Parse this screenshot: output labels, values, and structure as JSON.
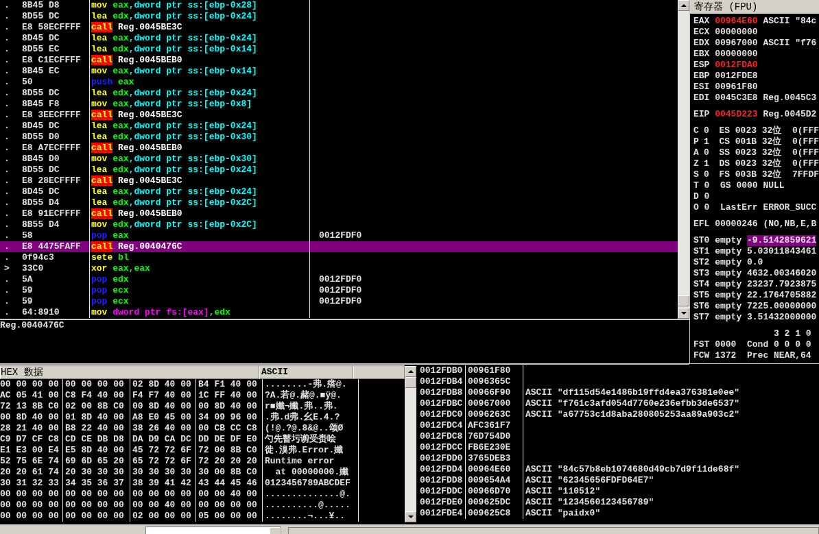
{
  "disassembly": {
    "rows": [
      {
        "marker": ".",
        "bytes": "8B45 D8",
        "instruction": [
          {
            "text": "mov",
            "kind": "op"
          },
          {
            "text": " eax",
            "kind": "reg"
          },
          {
            "text": ",dword ptr ss:[ebp-0x28]",
            "kind": "mem"
          }
        ],
        "selected": false
      },
      {
        "marker": ".",
        "bytes": "8D55 DC",
        "instruction": [
          {
            "text": "lea",
            "kind": "op"
          },
          {
            "text": " edx",
            "kind": "reg"
          },
          {
            "text": ",dword ptr ss:[ebp-0x24]",
            "kind": "mem"
          }
        ],
        "selected": false
      },
      {
        "marker": ".",
        "bytes": "E8 58ECFFFF",
        "instruction": [
          {
            "text": "call",
            "kind": "call"
          },
          {
            "text": " Reg.0045BE3C",
            "kind": "addr"
          }
        ],
        "selected": false
      },
      {
        "marker": ".",
        "bytes": "8D45 DC",
        "instruction": [
          {
            "text": "lea",
            "kind": "op"
          },
          {
            "text": " eax",
            "kind": "reg"
          },
          {
            "text": ",dword ptr ss:[ebp-0x24]",
            "kind": "mem"
          }
        ],
        "selected": false
      },
      {
        "marker": ".",
        "bytes": "8D55 EC",
        "instruction": [
          {
            "text": "lea",
            "kind": "op"
          },
          {
            "text": " edx",
            "kind": "reg"
          },
          {
            "text": ",dword ptr ss:[ebp-0x14]",
            "kind": "mem"
          }
        ],
        "selected": false
      },
      {
        "marker": ".",
        "bytes": "E8 C1ECFFFF",
        "instruction": [
          {
            "text": "call",
            "kind": "call"
          },
          {
            "text": " Reg.0045BEB0",
            "kind": "addr"
          }
        ],
        "selected": false
      },
      {
        "marker": ".",
        "bytes": "8B45 EC",
        "instruction": [
          {
            "text": "mov",
            "kind": "op"
          },
          {
            "text": " eax",
            "kind": "reg"
          },
          {
            "text": ",dword ptr ss:[ebp-0x14]",
            "kind": "mem"
          }
        ],
        "selected": false
      },
      {
        "marker": ".",
        "bytes": "50",
        "instruction": [
          {
            "text": "push",
            "kind": "stack"
          },
          {
            "text": " eax",
            "kind": "reg"
          }
        ],
        "selected": false
      },
      {
        "marker": ".",
        "bytes": "8D55 DC",
        "instruction": [
          {
            "text": "lea",
            "kind": "op"
          },
          {
            "text": " edx",
            "kind": "reg"
          },
          {
            "text": ",dword ptr ss:[ebp-0x24]",
            "kind": "mem"
          }
        ],
        "selected": false
      },
      {
        "marker": ".",
        "bytes": "8B45 F8",
        "instruction": [
          {
            "text": "mov",
            "kind": "op"
          },
          {
            "text": " eax",
            "kind": "reg"
          },
          {
            "text": ",dword ptr ss:[ebp-0x8]",
            "kind": "mem"
          }
        ],
        "selected": false
      },
      {
        "marker": ".",
        "bytes": "E8 3EECFFFF",
        "instruction": [
          {
            "text": "call",
            "kind": "call"
          },
          {
            "text": " Reg.0045BE3C",
            "kind": "addr"
          }
        ],
        "selected": false
      },
      {
        "marker": ".",
        "bytes": "8D45 DC",
        "instruction": [
          {
            "text": "lea",
            "kind": "op"
          },
          {
            "text": " eax",
            "kind": "reg"
          },
          {
            "text": ",dword ptr ss:[ebp-0x24]",
            "kind": "mem"
          }
        ],
        "selected": false
      },
      {
        "marker": ".",
        "bytes": "8D55 D0",
        "instruction": [
          {
            "text": "lea",
            "kind": "op"
          },
          {
            "text": " edx",
            "kind": "reg"
          },
          {
            "text": ",dword ptr ss:[ebp-0x30]",
            "kind": "mem"
          }
        ],
        "selected": false
      },
      {
        "marker": ".",
        "bytes": "E8 A7ECFFFF",
        "instruction": [
          {
            "text": "call",
            "kind": "call"
          },
          {
            "text": " Reg.0045BEB0",
            "kind": "addr"
          }
        ],
        "selected": false
      },
      {
        "marker": ".",
        "bytes": "8B45 D0",
        "instruction": [
          {
            "text": "mov",
            "kind": "op"
          },
          {
            "text": " eax",
            "kind": "reg"
          },
          {
            "text": ",dword ptr ss:[ebp-0x30]",
            "kind": "mem"
          }
        ],
        "selected": false
      },
      {
        "marker": ".",
        "bytes": "8D55 DC",
        "instruction": [
          {
            "text": "lea",
            "kind": "op"
          },
          {
            "text": " edx",
            "kind": "reg"
          },
          {
            "text": ",dword ptr ss:[ebp-0x24]",
            "kind": "mem"
          }
        ],
        "selected": false
      },
      {
        "marker": ".",
        "bytes": "E8 28ECFFFF",
        "instruction": [
          {
            "text": "call",
            "kind": "call"
          },
          {
            "text": " Reg.0045BE3C",
            "kind": "addr"
          }
        ],
        "selected": false
      },
      {
        "marker": ".",
        "bytes": "8D45 DC",
        "instruction": [
          {
            "text": "lea",
            "kind": "op"
          },
          {
            "text": " eax",
            "kind": "reg"
          },
          {
            "text": ",dword ptr ss:[ebp-0x24]",
            "kind": "mem"
          }
        ],
        "selected": false
      },
      {
        "marker": ".",
        "bytes": "8D55 D4",
        "instruction": [
          {
            "text": "lea",
            "kind": "op"
          },
          {
            "text": " edx",
            "kind": "reg"
          },
          {
            "text": ",dword ptr ss:[ebp-0x2C]",
            "kind": "mem"
          }
        ],
        "selected": false
      },
      {
        "marker": ".",
        "bytes": "E8 91ECFFFF",
        "instruction": [
          {
            "text": "call",
            "kind": "call"
          },
          {
            "text": " Reg.0045BEB0",
            "kind": "addr"
          }
        ],
        "selected": false
      },
      {
        "marker": ".",
        "bytes": "8B55 D4",
        "instruction": [
          {
            "text": "mov",
            "kind": "op"
          },
          {
            "text": " edx",
            "kind": "reg"
          },
          {
            "text": ",dword ptr ss:[ebp-0x2C]",
            "kind": "mem"
          }
        ],
        "selected": false
      },
      {
        "marker": ".",
        "bytes": "58",
        "instruction": [
          {
            "text": "pop",
            "kind": "stack"
          },
          {
            "text": " eax",
            "kind": "reg"
          }
        ],
        "comment": "0012FDF0",
        "selected": false
      },
      {
        "marker": ".",
        "bytes": "E8 4475FAFF",
        "instruction": [
          {
            "text": "call",
            "kind": "call"
          },
          {
            "text": " Reg.0040476C",
            "kind": "addr"
          }
        ],
        "selected": true
      },
      {
        "marker": ".",
        "bytes": "0f94c3",
        "instruction": [
          {
            "text": "sete",
            "kind": "op"
          },
          {
            "text": " bl",
            "kind": "reg"
          }
        ],
        "selected": false
      },
      {
        "marker": ">",
        "bytes": "33C0",
        "instruction": [
          {
            "text": "xor",
            "kind": "op"
          },
          {
            "text": " eax,eax",
            "kind": "reg"
          }
        ],
        "selected": false
      },
      {
        "marker": ".",
        "bytes": "5A",
        "instruction": [
          {
            "text": "pop",
            "kind": "stack"
          },
          {
            "text": " edx",
            "kind": "reg"
          }
        ],
        "comment": "0012FDF0",
        "selected": false
      },
      {
        "marker": ".",
        "bytes": "59",
        "instruction": [
          {
            "text": "pop",
            "kind": "stack"
          },
          {
            "text": " ecx",
            "kind": "reg"
          }
        ],
        "comment": "0012FDF0",
        "selected": false
      },
      {
        "marker": ".",
        "bytes": "59",
        "instruction": [
          {
            "text": "pop",
            "kind": "stack"
          },
          {
            "text": " ecx",
            "kind": "reg"
          }
        ],
        "comment": "0012FDF0",
        "selected": false
      },
      {
        "marker": ".",
        "bytes": "64:8910",
        "instruction": [
          {
            "text": "mov",
            "kind": "op"
          },
          {
            "text": " dword ptr fs:[eax]",
            "kind": "seg"
          },
          {
            "text": ",edx",
            "kind": "reg"
          }
        ],
        "selected": false
      }
    ]
  },
  "info_pane": {
    "text": "Reg.0040476C"
  },
  "registers": {
    "title": "寄存器 (FPU)",
    "sections": [
      {
        "kind": "general",
        "rows": [
          {
            "label": "EAX",
            "value": "00964E60",
            "changed": true,
            "note": "ASCII \"84c"
          },
          {
            "label": "ECX",
            "value": "00000000",
            "changed": false
          },
          {
            "label": "EDX",
            "value": "00967000",
            "changed": false,
            "note": "ASCII \"f76"
          },
          {
            "label": "EBX",
            "value": "00000000",
            "changed": false
          },
          {
            "label": "ESP",
            "value": "0012FDA0",
            "changed": true
          },
          {
            "label": "EBP",
            "value": "0012FDE8",
            "changed": false
          },
          {
            "label": "ESI",
            "value": "00961F80",
            "changed": false
          },
          {
            "label": "EDI",
            "value": "0045C3E8",
            "changed": false,
            "note": "Reg.0045C3"
          }
        ]
      },
      {
        "kind": "general",
        "rows": [
          {
            "label": "EIP",
            "value": "0045D223",
            "changed": true,
            "note": "Reg.0045D2"
          }
        ]
      },
      {
        "kind": "flags",
        "rows": [
          {
            "label": "C",
            "value": "0",
            "note": "ES 0023 32位  0(FFF"
          },
          {
            "label": "P",
            "value": "1",
            "note": "CS 001B 32位  0(FFF"
          },
          {
            "label": "A",
            "value": "0",
            "note": "SS 0023 32位  0(FFF"
          },
          {
            "label": "Z",
            "value": "1",
            "note": "DS 0023 32位  0(FFF"
          },
          {
            "label": "S",
            "value": "0",
            "note": "FS 003B 32位  7FFDF"
          },
          {
            "label": "T",
            "value": "0",
            "note": "GS 0000 NULL"
          },
          {
            "label": "D",
            "value": "0"
          },
          {
            "label": "O",
            "value": "0",
            "note": "LastErr ERROR_SUCC"
          }
        ]
      },
      {
        "kind": "general",
        "rows": [
          {
            "label": "EFL",
            "value": "00000246",
            "changed": false,
            "note": "(NO,NB,E,B"
          }
        ]
      },
      {
        "kind": "fpu",
        "rows": [
          {
            "label": "ST0",
            "value": "empty",
            "note": "-9.5142859621",
            "highlighted": true
          },
          {
            "label": "ST1",
            "value": "empty",
            "note": "5.03011843461",
            "highlighted": false
          },
          {
            "label": "ST2",
            "value": "empty",
            "note": "0.0",
            "highlighted": false
          },
          {
            "label": "ST3",
            "value": "empty",
            "note": "4632.00346020",
            "highlighted": false
          },
          {
            "label": "ST4",
            "value": "empty",
            "note": "23237.7923875",
            "highlighted": false
          },
          {
            "label": "ST5",
            "value": "empty",
            "note": "22.1764705882",
            "highlighted": false
          },
          {
            "label": "ST6",
            "value": "empty",
            "note": "7225.00000000",
            "highlighted": false
          },
          {
            "label": "ST7",
            "value": "empty",
            "note": "3.51432000000",
            "highlighted": false
          }
        ]
      },
      {
        "kind": "status",
        "rows": [
          {
            "kind": "header",
            "note": "3 2 1 0"
          },
          {
            "kind": "register",
            "label": "FST",
            "value": "0000",
            "note": "Cond 0 0 0 0"
          },
          {
            "kind": "register",
            "label": "FCW",
            "value": "1372",
            "note": "Prec NEAR,64"
          }
        ]
      }
    ]
  },
  "dump": {
    "columns": [
      "HEX 数据",
      "ASCII"
    ],
    "rows": [
      {
        "bytes": [
          "00 00 00 00",
          "00 00 00 00",
          "02 8D 40 00",
          "B4 F1 40 00"
        ],
        "ascii": "........-弗.瘩@."
      },
      {
        "bytes": [
          "AC 05 41 00",
          "C8 F4 40 00",
          "F4 F7 40 00",
          "1C FF 40 00"
        ],
        "ascii": "?A.若@.赭@.■ÿ@."
      },
      {
        "bytes": [
          "72 13 8B C0",
          "02 00 8B C0",
          "00 8D 40 00",
          "00 8D 40 00"
        ],
        "ascii": "r■孅¬孅.弗..弗."
      },
      {
        "bytes": [
          "00 8D 40 00",
          "01 8D 40 00",
          "A8 E0 45 00",
          "34 09 96 00"
        ],
        "ascii": ".弗.d弗.幺E.4.?"
      },
      {
        "bytes": [
          "28 21 40 00",
          "B8 22 40 00",
          "38 26 40 00",
          "00 CB CC C8"
        ],
        "ascii": "(!@.?@.8&@..颂Ø"
      },
      {
        "bytes": [
          "C9 D7 CF C8",
          "CD CE DB D8",
          "DA D9 CA DC",
          "DD DE DF E0"
        ],
        "ascii": "勺先瞽圬谫受赉哙"
      },
      {
        "bytes": [
          "E1 E3 00 E4",
          "E5 8D 40 00",
          "45 72 72 6F",
          "72 00 8B C0"
        ],
        "ascii": "徙.溴弗.Error.孅"
      },
      {
        "bytes": [
          "52 75 6E 74",
          "69 6D 65 20",
          "65 72 72 6F",
          "72 20 20 20"
        ],
        "ascii": "Runtime error"
      },
      {
        "bytes": [
          "20 20 61 74",
          "20 30 30 30",
          "30 30 30 30",
          "30 00 8B C0"
        ],
        "ascii": "  at 00000000.孅"
      },
      {
        "bytes": [
          "30 31 32 33",
          "34 35 36 37",
          "38 39 41 42",
          "43 44 45 46"
        ],
        "ascii": "0123456789ABCDEF"
      },
      {
        "bytes": [
          "00 00 00 00",
          "00 00 00 00",
          "00 00 00 00",
          "00 00 40 00"
        ],
        "ascii": "..............@."
      },
      {
        "bytes": [
          "00 00 00 00",
          "00 00 00 00",
          "00 00 40 00",
          "00 00 00 00"
        ],
        "ascii": "..........@....."
      },
      {
        "bytes": [
          "00 00 00 00",
          "00 00 00 00",
          "02 00 00 00",
          "05 00 00 00"
        ],
        "ascii": "........¬...¥.."
      }
    ]
  },
  "stack": {
    "rows": [
      {
        "address": "0012FDB0",
        "value": "00961F80"
      },
      {
        "address": "0012FDB4",
        "value": "0096365C"
      },
      {
        "address": "0012FDB8",
        "value": "00966F90",
        "comment": "ASCII \"df115d54e1486b19ffd4ea376381e0ee\""
      },
      {
        "address": "0012FDBC",
        "value": "00967000",
        "comment": "ASCII \"f761c3afd054d7760e236efbb3de6537\""
      },
      {
        "address": "0012FDC0",
        "value": "0096263C",
        "comment": "ASCII \"a67753c1d8aba280805253aa89a903c2\""
      },
      {
        "address": "0012FDC4",
        "value": "AFC361F7"
      },
      {
        "address": "0012FDC8",
        "value": "76D754D0"
      },
      {
        "address": "0012FDCC",
        "value": "FB6E230E"
      },
      {
        "address": "0012FDD0",
        "value": "3765DEB3"
      },
      {
        "address": "0012FDD4",
        "value": "00964E60",
        "comment": "ASCII \"84c57b8eb1074680d49cb7d9f11de68f\""
      },
      {
        "address": "0012FDD8",
        "value": "009654A4",
        "comment": "ASCII \"62345656FDFD64E7\""
      },
      {
        "address": "0012FDDC",
        "value": "00966D70",
        "comment": "ASCII \"110512\""
      },
      {
        "address": "0012FDE0",
        "value": "009625DC",
        "comment": "ASCII \"1234560123456789\""
      },
      {
        "address": "0012FDE4",
        "value": "009625C8",
        "comment": "ASCII \"paidx0\""
      }
    ]
  }
}
